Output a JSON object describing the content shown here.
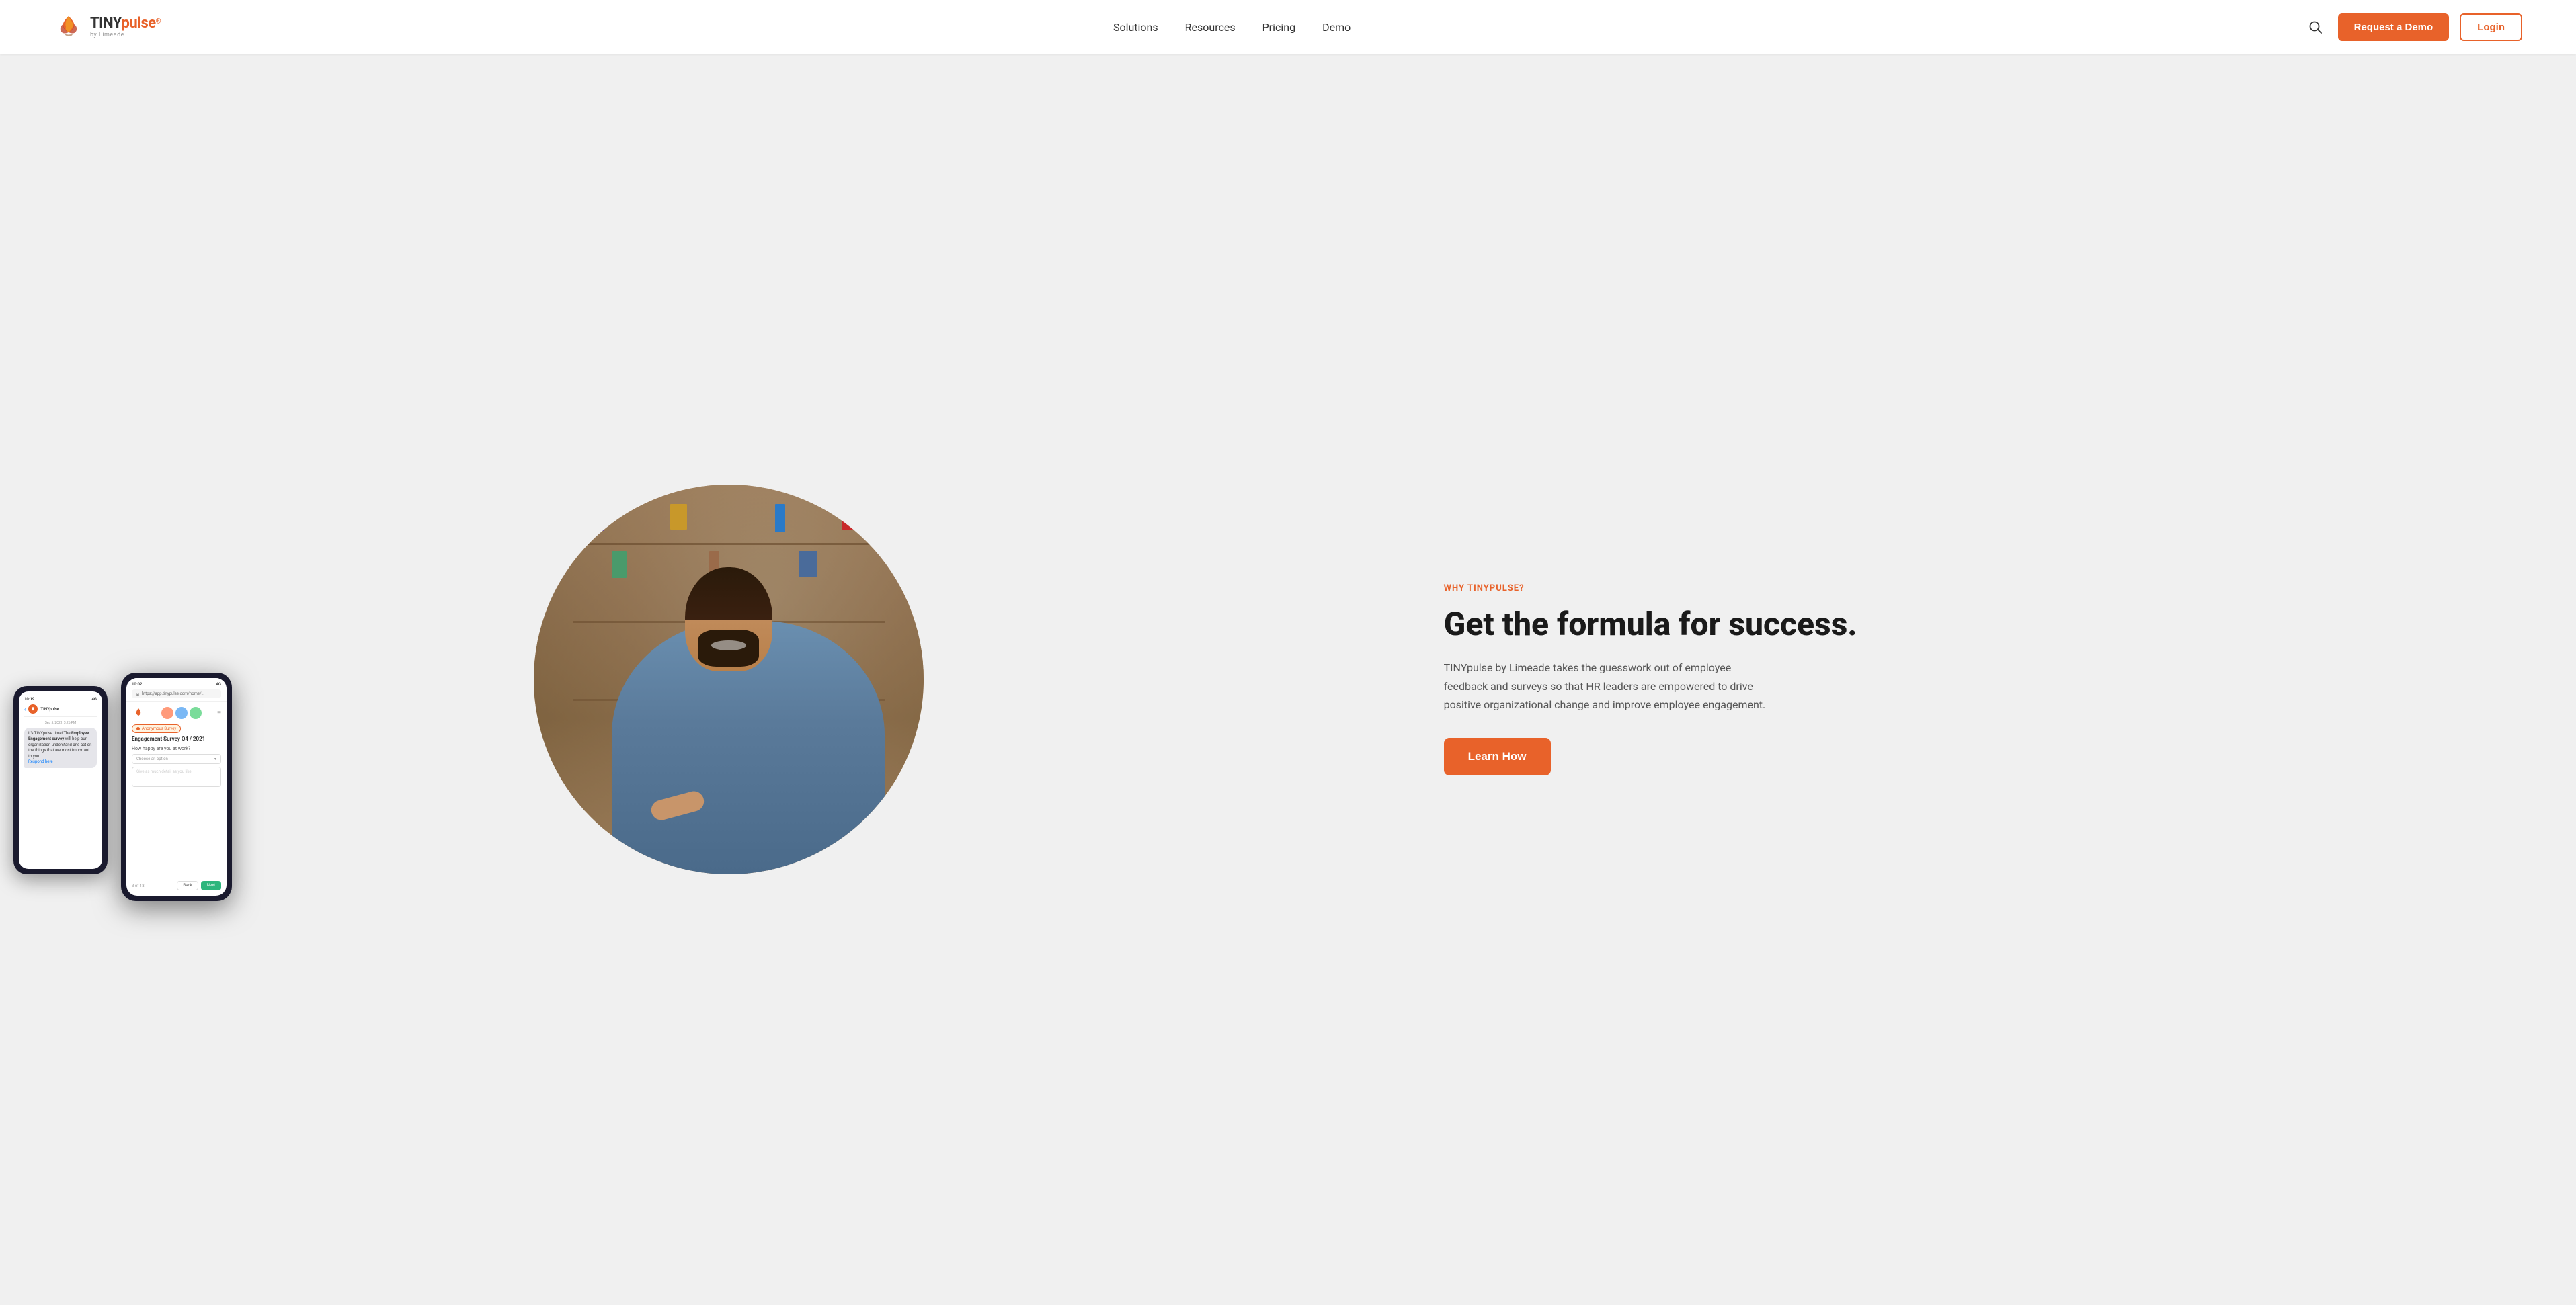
{
  "navbar": {
    "logo": {
      "tiny": "TINY",
      "pulse": "pulse",
      "superscript": "®",
      "sub": "by Limeade"
    },
    "nav_links": [
      {
        "id": "solutions",
        "label": "Solutions"
      },
      {
        "id": "resources",
        "label": "Resources"
      },
      {
        "id": "pricing",
        "label": "Pricing"
      },
      {
        "id": "demo",
        "label": "Demo"
      }
    ],
    "request_demo_label": "Request a Demo",
    "login_label": "Login"
  },
  "hero": {
    "eyebrow": "WHY TINYPULSE?",
    "title": "Get the formula for success.",
    "description": "TINYpulse by Limeade takes the guesswork out of employee feedback and surveys so that HR leaders are empowered to drive positive organizational change and improve employee engagement.",
    "cta_label": "Learn How"
  },
  "phone1": {
    "time": "10:19",
    "signal": "4G",
    "brand": "TINYpulse I",
    "time_sent": "Sep 5, 2021, 3:26 PM",
    "message_line1": "It's TINYpulse time! The",
    "message_bold": "Employee Engagement survey",
    "message_line2": "will help our organization understand and act on the things that are most important to you.",
    "link": "Respond here"
  },
  "phone2": {
    "time": "10:02",
    "signal": "4G",
    "url": "https://app.tinypulse.com/home/...",
    "badge": "Anonymous Survey",
    "survey_title": "Engagement Survey Q4 / 2021",
    "question": "How happy are you at work?",
    "dropdown_placeholder": "Choose an option",
    "textarea_placeholder": "Give as much detail as you like.",
    "page_indicator": "3 of 18",
    "btn_back": "Back",
    "btn_next": "Next"
  },
  "colors": {
    "brand_orange": "#e8622a",
    "brand_dark": "#1a1a1a",
    "brand_green": "#2db67d"
  }
}
